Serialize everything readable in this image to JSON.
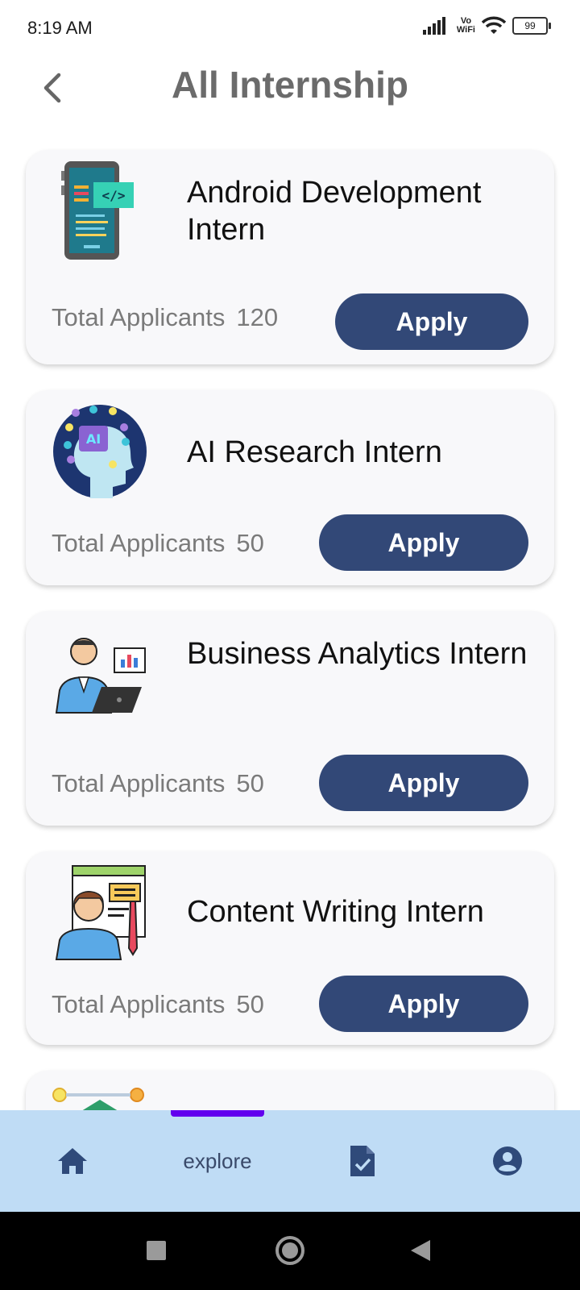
{
  "status_bar": {
    "time": "8:19 AM",
    "vowifi_top": "Vo",
    "vowifi_bottom": "WiFi",
    "battery": "99"
  },
  "header": {
    "title": "All Internship"
  },
  "applicants_label": "Total Applicants",
  "internships": [
    {
      "title": "Android Development Intern",
      "applicants": "120",
      "apply_label": "Apply",
      "icon": "android-development-icon"
    },
    {
      "title": "AI Research Intern",
      "applicants": "50",
      "apply_label": "Apply",
      "icon": "ai-research-icon"
    },
    {
      "title": "Business Analytics Intern",
      "applicants": "50",
      "apply_label": "Apply",
      "icon": "business-analytics-icon"
    },
    {
      "title": "Content Writing Intern",
      "applicants": "50",
      "apply_label": "Apply",
      "icon": "content-writing-icon"
    }
  ],
  "bottom_nav": {
    "items": [
      {
        "name": "home",
        "icon": "home-icon"
      },
      {
        "name": "explore",
        "label": "explore",
        "active": true
      },
      {
        "name": "applications",
        "icon": "document-check-icon"
      },
      {
        "name": "profile",
        "icon": "profile-icon"
      }
    ],
    "active_color": "#6200ee"
  },
  "colors": {
    "button": "#324877",
    "nav_background": "#bfdcf5",
    "title": "#6b6b6b"
  }
}
